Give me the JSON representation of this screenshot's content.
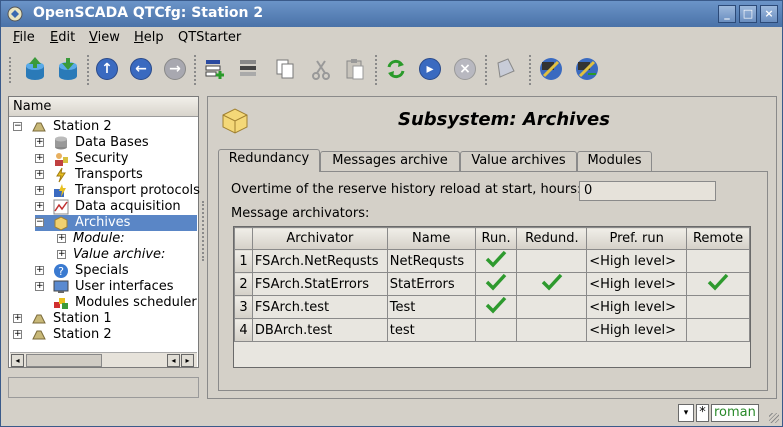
{
  "window": {
    "title": "OpenSCADA QTCfg: Station 2",
    "buttons": {
      "minimize": "_",
      "maximize": "□",
      "close": "×"
    }
  },
  "menu": {
    "items": [
      {
        "accel": "F",
        "rest": "ile"
      },
      {
        "accel": "E",
        "rest": "dit"
      },
      {
        "accel": "V",
        "rest": "iew"
      },
      {
        "accel": "H",
        "rest": "elp"
      },
      {
        "accel": "",
        "rest": "QTStarter"
      }
    ]
  },
  "toolbar": {
    "icons": [
      "db-load-icon",
      "db-save-icon",
      "up-icon",
      "back-icon",
      "forward-icon",
      "add-item-icon",
      "delete-item-icon",
      "copy-icon",
      "cut-icon",
      "paste-icon",
      "refresh-icon",
      "start-icon",
      "stop-icon",
      "info-icon",
      "remote-station-icon",
      "remote-station-settings-icon"
    ]
  },
  "tree": {
    "header": "Name",
    "items": [
      {
        "label": "Station 2",
        "level": 0
      },
      {
        "label": "Data Bases",
        "level": 1
      },
      {
        "label": "Security",
        "level": 1
      },
      {
        "label": "Transports",
        "level": 1
      },
      {
        "label": "Transport protocols",
        "level": 1
      },
      {
        "label": "Data acquisition",
        "level": 1
      },
      {
        "label": "Archives",
        "level": 1,
        "selected": true
      },
      {
        "label": "Module:",
        "level": 2
      },
      {
        "label": "Value archive:",
        "level": 2
      },
      {
        "label": "Specials",
        "level": 1
      },
      {
        "label": "User interfaces",
        "level": 1
      },
      {
        "label": "Modules scheduler",
        "level": 1
      },
      {
        "label": "Station 1",
        "level": 0
      },
      {
        "label": "Station 2",
        "level": 0
      }
    ]
  },
  "page": {
    "title": "Subsystem: Archives",
    "tabs": [
      "Redundancy",
      "Messages archive",
      "Value archives",
      "Modules"
    ],
    "active_tab": 0,
    "overtime_label": "Overtime of the reserve history reload at start, hours:",
    "overtime_value": "0",
    "msg_archivators_label": "Message archivators:",
    "table": {
      "columns": [
        "Archivator",
        "Name",
        "Run.",
        "Redund.",
        "Pref. run",
        "Remote"
      ],
      "rows": [
        {
          "num": "1",
          "archivator": "FSArch.NetRequsts",
          "name": "NetRequsts",
          "run": true,
          "redund": false,
          "pref": "<High level>",
          "remote": false
        },
        {
          "num": "2",
          "archivator": "FSArch.StatErrors",
          "name": "StatErrors",
          "run": true,
          "redund": true,
          "pref": "<High level>",
          "remote": true
        },
        {
          "num": "3",
          "archivator": "FSArch.test",
          "name": "Test",
          "run": true,
          "redund": false,
          "pref": "<High level>",
          "remote": false
        },
        {
          "num": "4",
          "archivator": "DBArch.test",
          "name": "test",
          "run": false,
          "redund": false,
          "pref": "<High level>",
          "remote": false
        }
      ]
    }
  },
  "statusbar": {
    "modified": "*",
    "user": "roman"
  },
  "colors": {
    "title_bar": "#4a72a8",
    "selection": "#5a86c6",
    "check": "#2e9a2e"
  }
}
